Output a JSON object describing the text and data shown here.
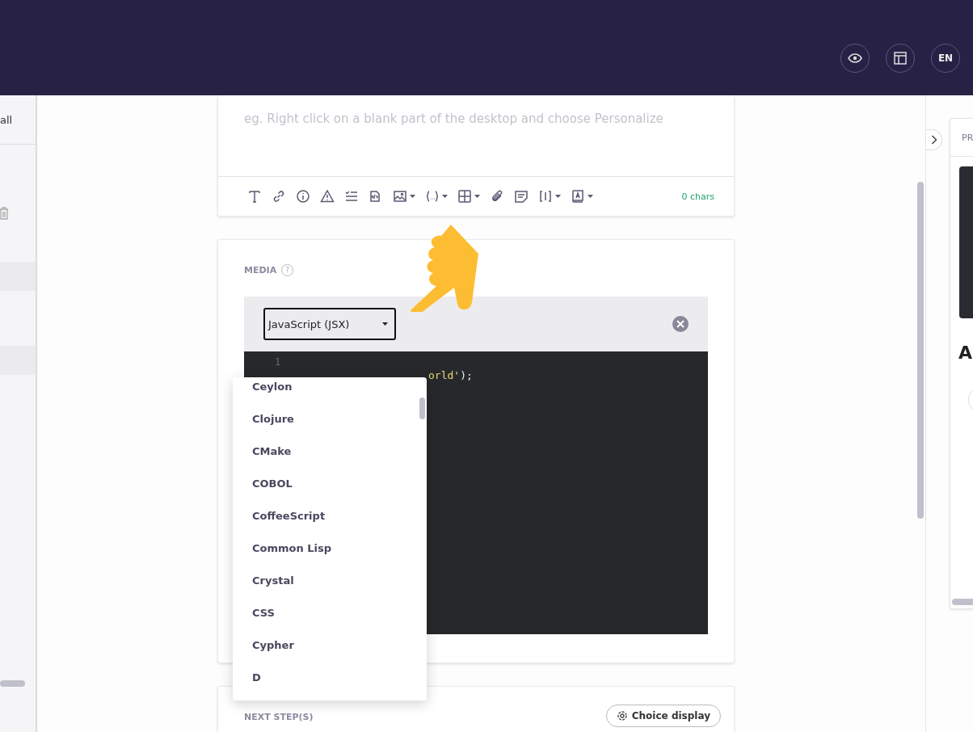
{
  "header": {
    "actions": [
      {
        "kind": "preview"
      },
      {
        "kind": "layout"
      },
      {
        "kind": "language",
        "label": "EN"
      }
    ]
  },
  "sidebar": {
    "link": "all"
  },
  "description_editor": {
    "placeholder": "eg. Right click on a blank part of the desktop and choose Personalize",
    "toolbar": [
      {
        "kind": "text"
      },
      {
        "kind": "link"
      },
      {
        "kind": "info"
      },
      {
        "kind": "warning"
      },
      {
        "kind": "checklist"
      },
      {
        "kind": "code"
      },
      {
        "kind": "image"
      },
      {
        "kind": "variable"
      },
      {
        "kind": "table"
      },
      {
        "kind": "attachment"
      },
      {
        "kind": "note"
      },
      {
        "kind": "bracket"
      },
      {
        "kind": "book"
      }
    ],
    "char_count": "0 chars"
  },
  "media": {
    "label": "MEDIA",
    "help": "?",
    "language_select": {
      "value": "JavaScript (JSX)"
    },
    "code": {
      "line_number": "1",
      "tail": "orld'",
      "end": ");"
    },
    "dropdown": [
      {
        "label": "Ceylon",
        "selected": false
      },
      {
        "label": "Clojure",
        "selected": false
      },
      {
        "label": "CMake",
        "selected": false
      },
      {
        "label": "COBOL",
        "selected": false
      },
      {
        "label": "CoffeeScript",
        "selected": false
      },
      {
        "label": "Common Lisp",
        "selected": false
      },
      {
        "label": "Crystal",
        "selected": false
      },
      {
        "label": "CSS",
        "selected": false
      },
      {
        "label": "Cypher",
        "selected": false
      },
      {
        "label": "D",
        "selected": false
      }
    ]
  },
  "next_steps": {
    "label": "NEXT STEP(S)",
    "button": "Choice display"
  },
  "preview_panel": {
    "tab": "PR",
    "heading": "A"
  }
}
